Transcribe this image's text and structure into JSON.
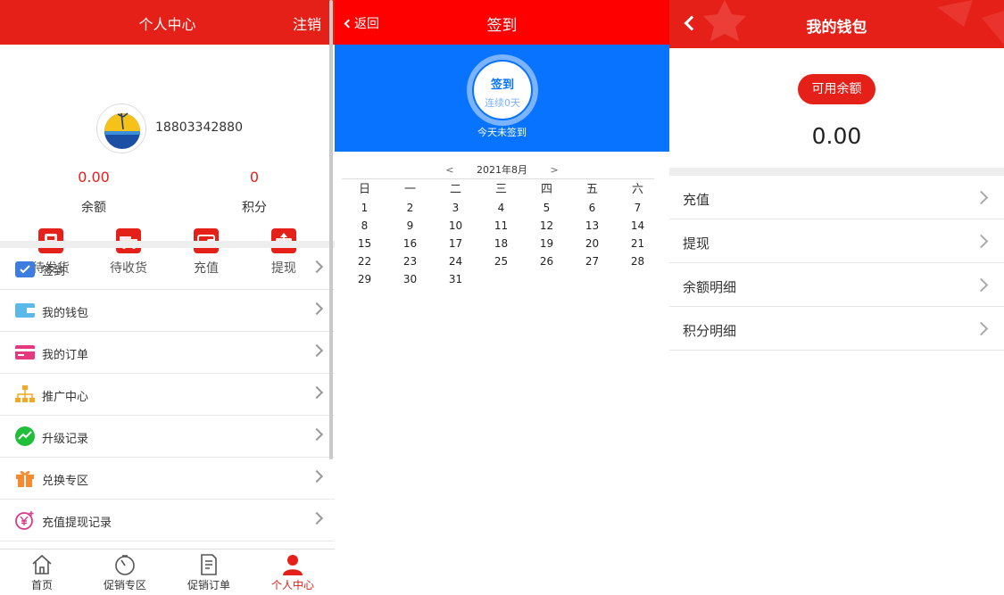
{
  "profile_screen": {
    "title": "个人中心",
    "logout": "注销",
    "phone": "18803342880",
    "balance_value": "0.00",
    "balance_label": "余额",
    "points_value": "0",
    "points_label": "积分",
    "quick_actions": [
      "待发货",
      "待收货",
      "充值",
      "提现"
    ],
    "menu": [
      "签到",
      "我的钱包",
      "我的订单",
      "推广中心",
      "升级记录",
      "兑换专区",
      "充值提现记录"
    ],
    "tabs": [
      "首页",
      "促销专区",
      "促销订单",
      "个人中心"
    ]
  },
  "signin_screen": {
    "back": "返回",
    "title": "签到",
    "sign_button": "签到",
    "streak": "连续0天",
    "today_status": "今天未签到",
    "prev": "<",
    "next": ">",
    "month": "2021年8月",
    "weekdays": [
      "日",
      "一",
      "二",
      "三",
      "四",
      "五",
      "六"
    ],
    "weeks": [
      [
        "1",
        "2",
        "3",
        "4",
        "5",
        "6",
        "7"
      ],
      [
        "8",
        "9",
        "10",
        "11",
        "12",
        "13",
        "14"
      ],
      [
        "15",
        "16",
        "17",
        "18",
        "19",
        "20",
        "21"
      ],
      [
        "22",
        "23",
        "24",
        "25",
        "26",
        "27",
        "28"
      ],
      [
        "29",
        "30",
        "31",
        "",
        "",
        "",
        ""
      ]
    ]
  },
  "wallet_screen": {
    "title": "我的钱包",
    "balance_label": "可用余额",
    "balance_value": "0.00",
    "items": [
      "充值",
      "提现",
      "余额明细",
      "积分明细"
    ]
  },
  "colors": {
    "primary_red": "#e52019",
    "header_red": "#fe0000",
    "sign_blue": "#0773ff"
  },
  "icons": {
    "quick_actions": [
      "pending-ship-icon",
      "pending-receive-icon",
      "recharge-wallet-icon",
      "withdraw-icon"
    ],
    "menu": [
      "calendar-check-icon",
      "wallet-icon",
      "card-icon",
      "org-tree-icon",
      "trend-icon",
      "gift-icon",
      "yen-coin-icon"
    ],
    "tabs": [
      "home-icon",
      "timer-icon",
      "document-icon",
      "user-icon"
    ]
  }
}
